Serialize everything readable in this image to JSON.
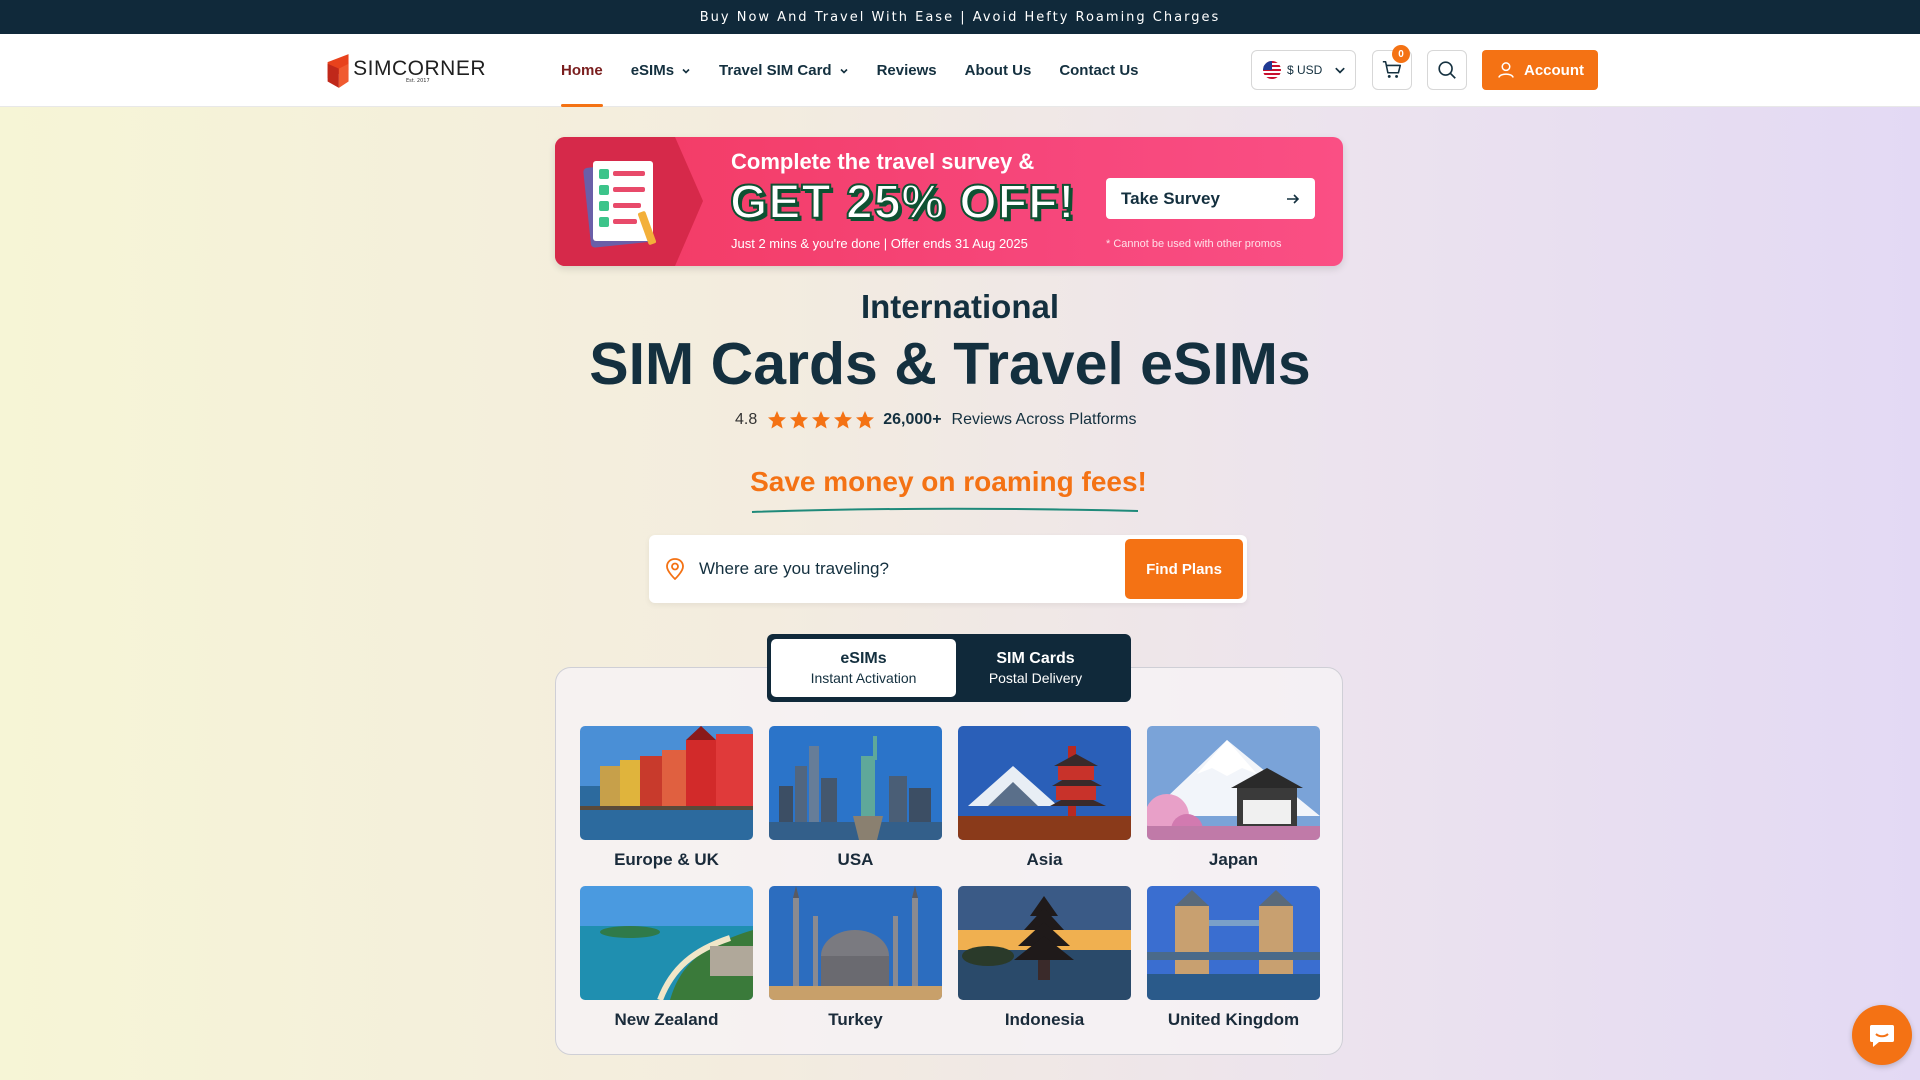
{
  "announcement": "Buy Now And Travel With Ease | Avoid Hefty Roaming Charges",
  "brand": {
    "name": "SIMCORNER",
    "est": "Est. 2017"
  },
  "nav": {
    "items": [
      {
        "label": "Home",
        "active": true,
        "dropdown": false
      },
      {
        "label": "eSIMs",
        "active": false,
        "dropdown": true
      },
      {
        "label": "Travel SIM Card",
        "active": false,
        "dropdown": true
      },
      {
        "label": "Reviews",
        "active": false,
        "dropdown": false
      },
      {
        "label": "About Us",
        "active": false,
        "dropdown": false
      },
      {
        "label": "Contact Us",
        "active": false,
        "dropdown": false
      }
    ],
    "currency": "$ USD",
    "cart_count": "0",
    "account_label": "Account"
  },
  "promo": {
    "line1": "Complete the travel survey &",
    "headline": "GET 25% OFF!",
    "subtext": "Just 2 mins & you're done | Offer ends 31 Aug 2025",
    "button_label": "Take Survey",
    "note": "* Cannot be used with other promos"
  },
  "hero": {
    "kicker": "International",
    "title": "SIM Cards & Travel eSIMs",
    "rating_score": "4.8",
    "stars": 5,
    "review_count": "26,000+",
    "review_text": "Reviews Across Platforms",
    "tagline": "Save money on roaming fees!"
  },
  "search": {
    "placeholder": "Where are you traveling?",
    "button_label": "Find Plans"
  },
  "tabs": [
    {
      "title": "eSIMs",
      "subtitle": "Instant Activation",
      "active": true
    },
    {
      "title": "SIM Cards",
      "subtitle": "Postal Delivery",
      "active": false
    }
  ],
  "destinations": [
    {
      "label": "Europe & UK"
    },
    {
      "label": "USA"
    },
    {
      "label": "Asia"
    },
    {
      "label": "Japan"
    },
    {
      "label": "New Zealand"
    },
    {
      "label": "Turkey"
    },
    {
      "label": "Indonesia"
    },
    {
      "label": "United Kingdom"
    }
  ],
  "colors": {
    "accent": "#f47214",
    "navy": "#10293a",
    "promo": "#f6467a"
  },
  "icons": [
    "chevron-down-icon",
    "us-flag-icon",
    "cart-icon",
    "search-icon",
    "user-icon",
    "arrow-right-icon",
    "location-pin-icon",
    "star-icon",
    "chat-icon"
  ]
}
